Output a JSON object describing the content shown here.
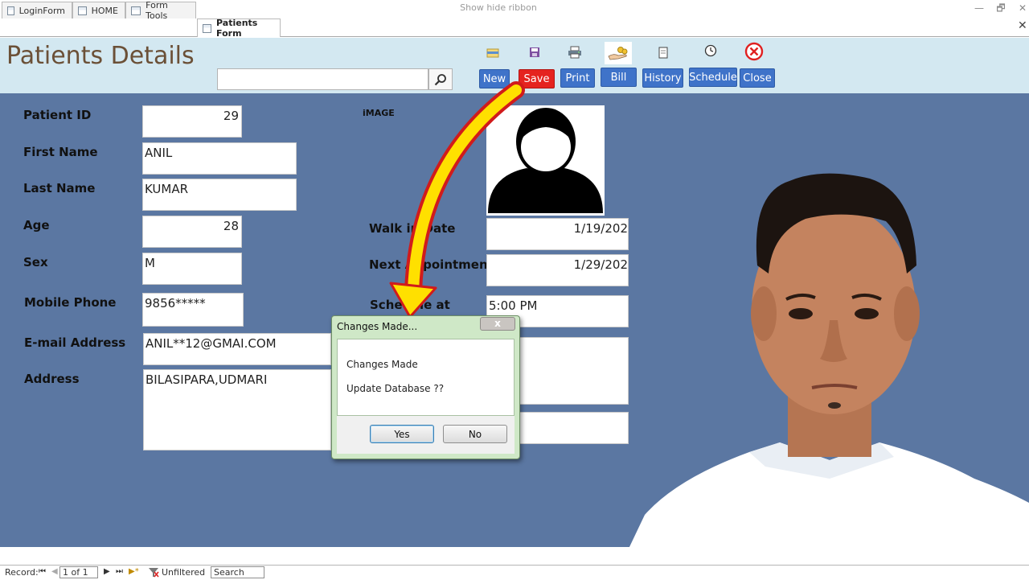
{
  "window": {
    "app_icon_letter": "A",
    "title": "Show hide ribbon",
    "controls": [
      "—",
      "🗗",
      "✕"
    ]
  },
  "tabs": [
    {
      "label": "LoginForm",
      "active": false
    },
    {
      "label": "HOME",
      "active": false
    },
    {
      "label": "Form Tools",
      "active": false
    },
    {
      "label": "Patients Form",
      "active": true
    }
  ],
  "header": {
    "title": "Patients Details",
    "search": {
      "value": "",
      "placeholder": ""
    }
  },
  "toolbar": {
    "new": "New",
    "save": "Save",
    "print": "Print",
    "bill": "Bill",
    "history": "History",
    "schedule": "Schedule",
    "close": "Close"
  },
  "form": {
    "patient_id": {
      "label": "Patient ID",
      "value": "29"
    },
    "first_name": {
      "label": "First Name",
      "value": "ANIL"
    },
    "last_name": {
      "label": "Last Name",
      "value": "KUMAR"
    },
    "age": {
      "label": "Age",
      "value": "28"
    },
    "sex": {
      "label": "Sex",
      "value": "M"
    },
    "mobile": {
      "label": "Mobile Phone",
      "value": "9856*****"
    },
    "email": {
      "label": "E-mail Address",
      "value": "ANIL**12@GMAI.COM"
    },
    "address": {
      "label": "Address",
      "value": "BILASIPARA,UDMARI"
    },
    "image_label": "iMAGE",
    "walk_in": {
      "label": "Walk in Date",
      "value": "1/19/202"
    },
    "next_appt": {
      "label": "Next Appointment",
      "value": "1/29/202"
    },
    "schedule_at": {
      "label": "Schedule at",
      "value": "5:00 PM"
    }
  },
  "dialog": {
    "title": "Changes Made...",
    "close": "x",
    "line1": "Changes Made",
    "line2": "Update Database ??",
    "yes": "Yes",
    "no": "No"
  },
  "status": {
    "record_label": "Record:",
    "record_value": "1 of 1",
    "filter": "Unfiltered",
    "search": "Search"
  },
  "colors": {
    "header_bg": "#d3e8f1",
    "form_bg": "#5b77a2",
    "accent_blue": "#3f73c9",
    "save_red": "#e5231f",
    "title_brown": "#6b5037",
    "arrow_yellow": "#ffe000",
    "dialog_green": "#cfe8c7"
  }
}
